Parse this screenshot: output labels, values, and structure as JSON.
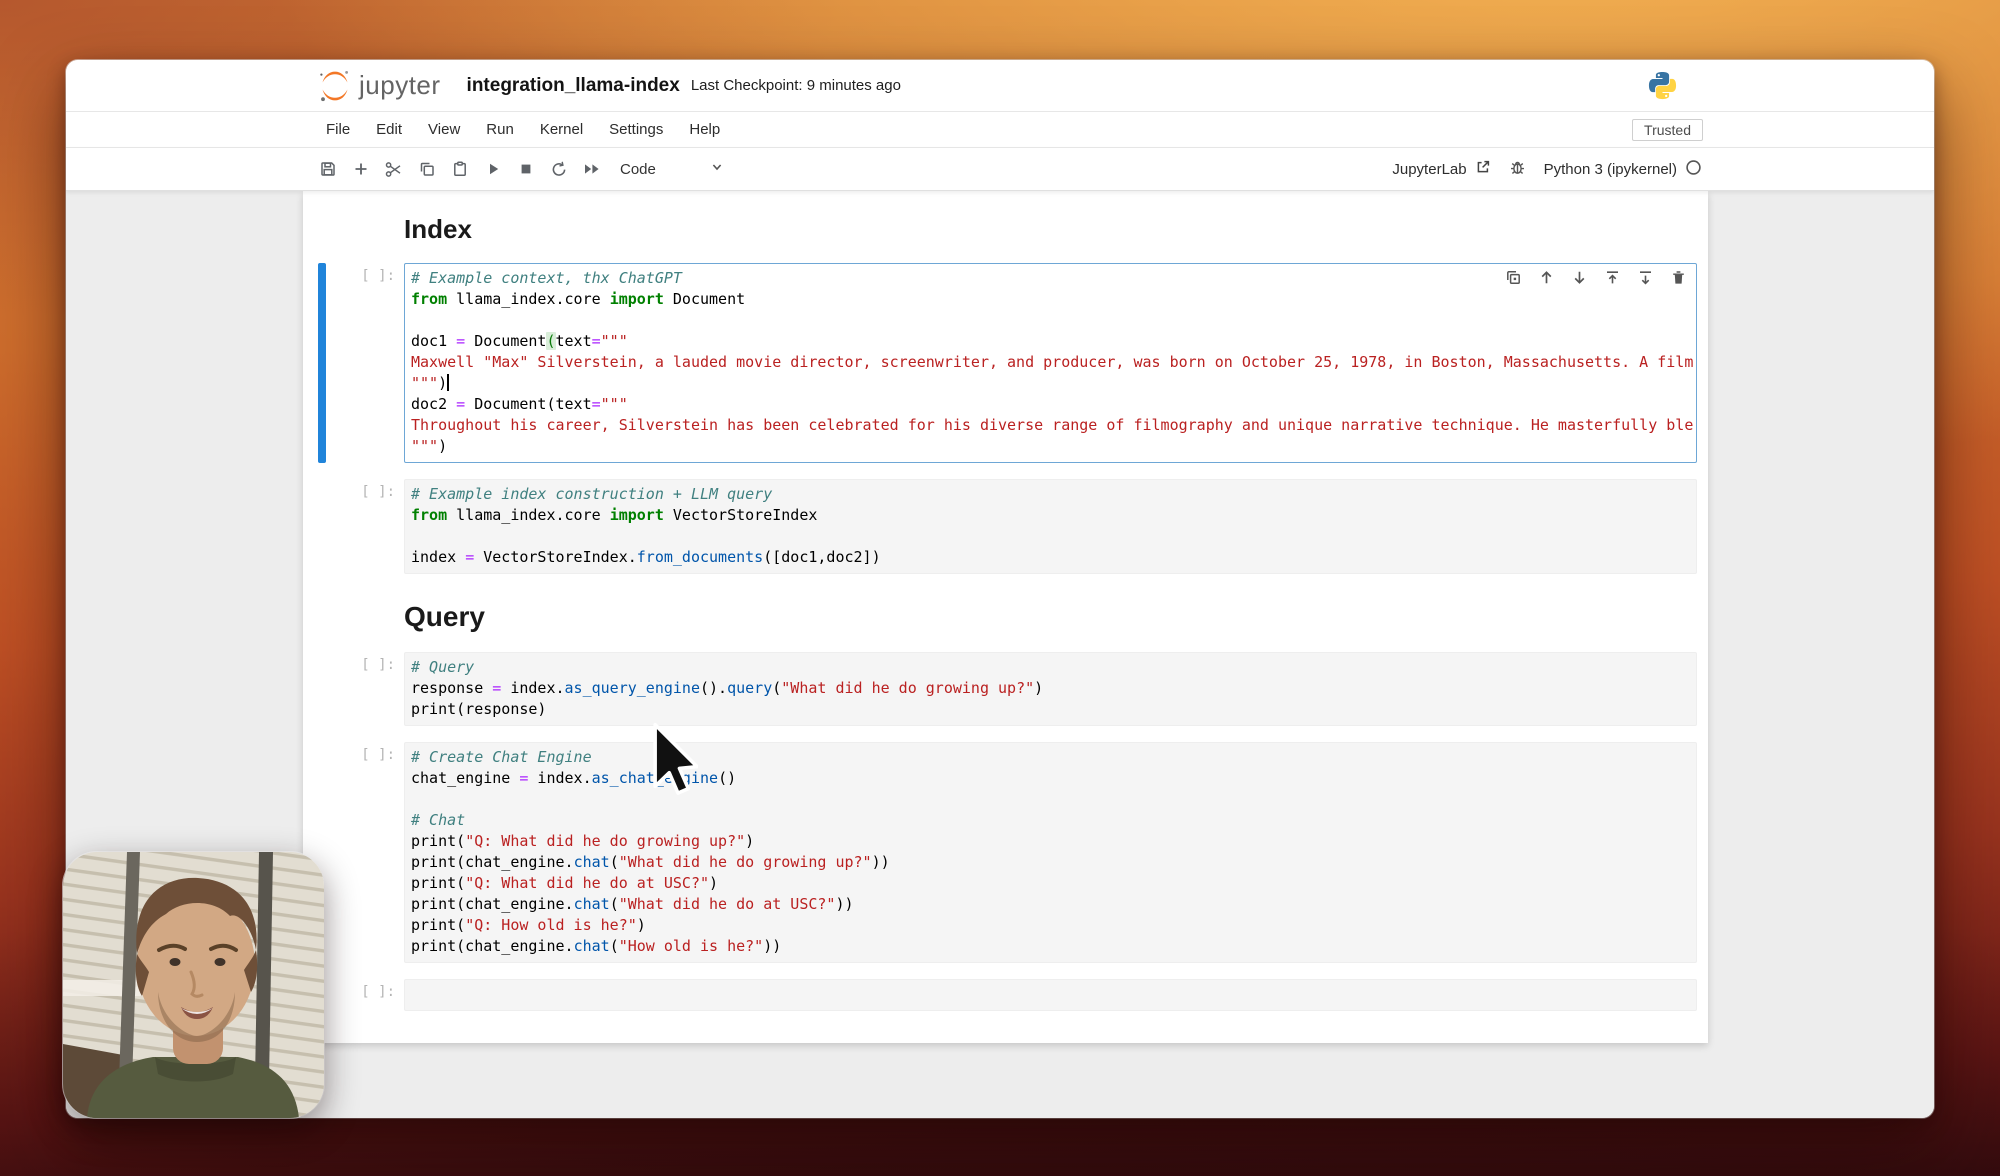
{
  "header": {
    "brand": "jupyter",
    "notebook_title": "integration_llama-index",
    "checkpoint": "Last Checkpoint: 9 minutes ago",
    "icons": [
      "jupyter-logo-icon",
      "python-logo-icon"
    ]
  },
  "menu": {
    "items": [
      "File",
      "Edit",
      "View",
      "Run",
      "Kernel",
      "Settings",
      "Help"
    ],
    "trusted_badge": "Trusted"
  },
  "toolbar": {
    "icons": [
      "save-icon",
      "add-cell-icon",
      "cut-cell-icon",
      "copy-cell-icon",
      "paste-cell-icon",
      "run-cell-icon",
      "stop-kernel-icon",
      "restart-kernel-icon",
      "run-all-icon"
    ],
    "cell_type_value": "Code",
    "cell_type_chevron": "chevron-down-icon",
    "jupyterlab_label": "JupyterLab",
    "right_icons": [
      "external-link-icon",
      "debugger-bug-icon",
      "kernel-status-icon"
    ],
    "kernel_label": "Python 3 (ipykernel)"
  },
  "cell_toolbar_icons": [
    "duplicate-cell-icon",
    "move-cell-up-icon",
    "move-cell-down-icon",
    "insert-cell-above-icon",
    "insert-cell-below-icon",
    "delete-cell-icon"
  ],
  "colors": {
    "brand_orange": "#f37726",
    "selected_cell_bar": "#2084da",
    "selected_cell_border": "#6ea7d6",
    "keyword": "#008000",
    "string": "#BA2121",
    "comment": "#408080",
    "operator": "#AA22FF",
    "property": "#0055aa"
  },
  "notebook": {
    "cells": [
      {
        "heading": "Index",
        "prompt": "[ ]:",
        "selected": true,
        "lines": [
          [
            {
              "c": "com",
              "t": "# Example context, thx ChatGPT"
            }
          ],
          [
            {
              "c": "kw",
              "t": "from"
            },
            {
              "t": " llama_index.core "
            },
            {
              "c": "kw",
              "t": "import"
            },
            {
              "t": " Document"
            }
          ],
          [],
          [
            {
              "t": "doc1 "
            },
            {
              "c": "op",
              "t": "="
            },
            {
              "t": " Document"
            },
            {
              "c": "brk",
              "t": "("
            },
            {
              "t": "text"
            },
            {
              "c": "op",
              "t": "="
            },
            {
              "c": "str",
              "t": "\"\"\""
            }
          ],
          [
            {
              "c": "str",
              "t": "Maxwell \"Max\" Silverstein, a lauded movie director, screenwriter, and producer, was born on October 25, 1978, in Boston, Massachusetts. A film"
            }
          ],
          [
            {
              "c": "str",
              "t": "\"\"\""
            },
            {
              "t": ")"
            },
            {
              "t": "",
              "caret": true
            }
          ],
          [
            {
              "t": "doc2 "
            },
            {
              "c": "op",
              "t": "="
            },
            {
              "t": " Document(text"
            },
            {
              "c": "op",
              "t": "="
            },
            {
              "c": "str",
              "t": "\"\"\""
            }
          ],
          [
            {
              "c": "str",
              "t": "Throughout his career, Silverstein has been celebrated for his diverse range of filmography and unique narrative technique. He masterfully ble"
            }
          ],
          [
            {
              "c": "str",
              "t": "\"\"\""
            },
            {
              "t": ")"
            }
          ]
        ]
      },
      {
        "heading": null,
        "prompt": "[ ]:",
        "selected": false,
        "lines": [
          [
            {
              "c": "com",
              "t": "# Example index construction + LLM query"
            }
          ],
          [
            {
              "c": "kw",
              "t": "from"
            },
            {
              "t": " llama_index.core "
            },
            {
              "c": "kw",
              "t": "import"
            },
            {
              "t": " VectorStoreIndex"
            }
          ],
          [],
          [
            {
              "t": "index "
            },
            {
              "c": "op",
              "t": "="
            },
            {
              "t": " VectorStoreIndex."
            },
            {
              "c": "prop",
              "t": "from_documents"
            },
            {
              "t": "([doc1,doc2])"
            }
          ]
        ]
      },
      {
        "heading": "Query",
        "prompt": "[ ]:",
        "selected": false,
        "lines": [
          [
            {
              "c": "com",
              "t": "# Query"
            }
          ],
          [
            {
              "t": "response "
            },
            {
              "c": "op",
              "t": "="
            },
            {
              "t": " index."
            },
            {
              "c": "prop",
              "t": "as_query_engine"
            },
            {
              "t": "()."
            },
            {
              "c": "prop",
              "t": "query"
            },
            {
              "t": "("
            },
            {
              "c": "str",
              "t": "\"What did he do growing up?\""
            },
            {
              "t": ")"
            }
          ],
          [
            {
              "t": "print(response)"
            }
          ]
        ]
      },
      {
        "heading": null,
        "prompt": "[ ]:",
        "selected": false,
        "lines": [
          [
            {
              "c": "com",
              "t": "# Create Chat Engine"
            }
          ],
          [
            {
              "t": "chat_engine "
            },
            {
              "c": "op",
              "t": "="
            },
            {
              "t": " index."
            },
            {
              "c": "prop",
              "t": "as_chat_engine"
            },
            {
              "t": "()"
            }
          ],
          [],
          [
            {
              "c": "com",
              "t": "# Chat"
            }
          ],
          [
            {
              "t": "print("
            },
            {
              "c": "str",
              "t": "\"Q: What did he do growing up?\""
            },
            {
              "t": ")"
            }
          ],
          [
            {
              "t": "print(chat_engine."
            },
            {
              "c": "prop",
              "t": "chat"
            },
            {
              "t": "("
            },
            {
              "c": "str",
              "t": "\"What did he do growing up?\""
            },
            {
              "t": "))"
            }
          ],
          [
            {
              "t": "print("
            },
            {
              "c": "str",
              "t": "\"Q: What did he do at USC?\""
            },
            {
              "t": ")"
            }
          ],
          [
            {
              "t": "print(chat_engine."
            },
            {
              "c": "prop",
              "t": "chat"
            },
            {
              "t": "("
            },
            {
              "c": "str",
              "t": "\"What did he do at USC?\""
            },
            {
              "t": "))"
            }
          ],
          [
            {
              "t": "print("
            },
            {
              "c": "str",
              "t": "\"Q: How old is he?\""
            },
            {
              "t": ")"
            }
          ],
          [
            {
              "t": "print(chat_engine."
            },
            {
              "c": "prop",
              "t": "chat"
            },
            {
              "t": "("
            },
            {
              "c": "str",
              "t": "\"How old is he?\""
            },
            {
              "t": "))"
            }
          ]
        ]
      },
      {
        "heading": null,
        "prompt": "[ ]:",
        "selected": false,
        "lines": [
          []
        ]
      }
    ]
  },
  "overlays": {
    "webcam": "presenter-webcam-video",
    "cursor": "mouse-cursor"
  }
}
